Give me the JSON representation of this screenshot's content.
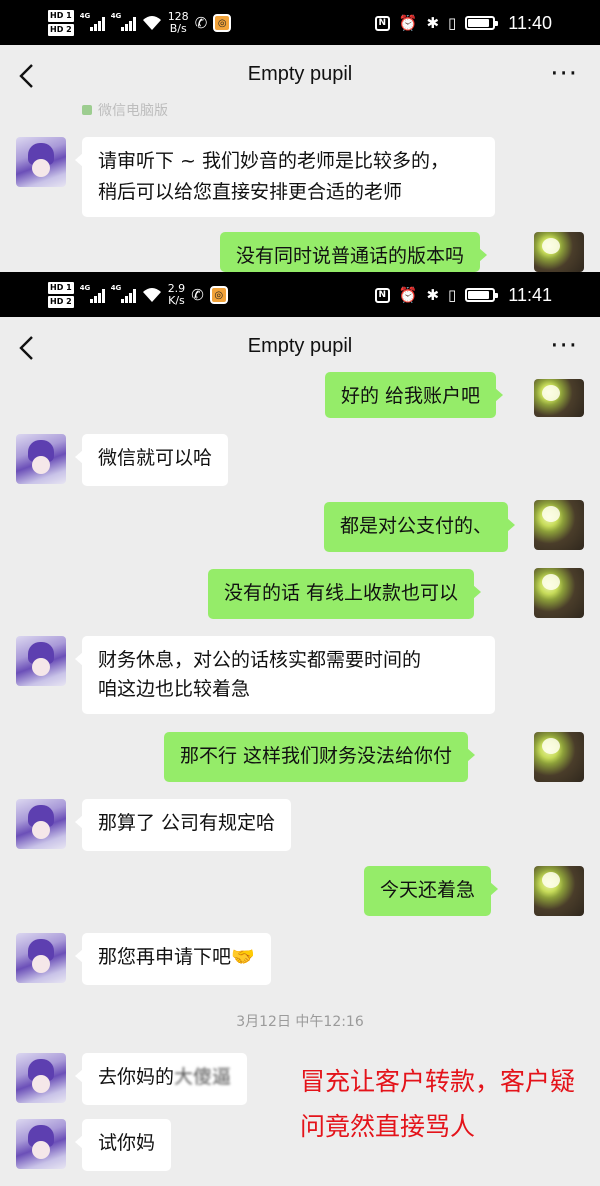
{
  "screen1": {
    "status": {
      "sim1": "HD 1",
      "sim2": "HD 2",
      "net": "4G",
      "speed_value": "128",
      "speed_unit": "B/s",
      "time": "11:40"
    },
    "header": {
      "title": "Empty pupil"
    },
    "cut_text": "微信电脑版",
    "messages": [
      {
        "side": "left",
        "lines": [
          "请审听下 ~ 我们妙音的老师是比较多的，",
          "稍后可以给您直接安排更合适的老师"
        ]
      },
      {
        "side": "right",
        "lines": [
          "没有同时说普通话的版本吗"
        ]
      }
    ]
  },
  "screen2": {
    "status": {
      "sim1": "HD 1",
      "sim2": "HD 2",
      "net": "4G",
      "speed_value": "2.9",
      "speed_unit": "K/s",
      "time": "11:41"
    },
    "header": {
      "title": "Empty pupil"
    },
    "messages": [
      {
        "side": "right",
        "text": "好的 给我账户吧"
      },
      {
        "side": "left",
        "text": "微信就可以哈"
      },
      {
        "side": "right",
        "text": "都是对公支付的、"
      },
      {
        "side": "right",
        "text": "没有的话  有线上收款也可以"
      },
      {
        "side": "left",
        "lines": [
          "财务休息，对公的话核实都需要时间的",
          "咱这边也比较着急"
        ]
      },
      {
        "side": "right",
        "text": "那不行  这样我们财务没法给你付"
      },
      {
        "side": "left",
        "text": "那算了 公司有规定哈"
      },
      {
        "side": "right",
        "text": "今天还着急"
      },
      {
        "side": "left",
        "text": "那您再申请下吧",
        "emoji": "🤝"
      }
    ],
    "timestamp": "3月12日 中午12:16",
    "messages_after": [
      {
        "side": "left",
        "text": "去你妈的",
        "blurred": "大傻逼"
      },
      {
        "side": "left",
        "text": "试你妈"
      }
    ],
    "annotation": {
      "line1": "冒充让客户转款，客户疑",
      "line2": "问竟然直接骂人",
      "color": "#e4131a"
    }
  },
  "colors": {
    "bubble_right": "#95ec69",
    "bubble_left": "#ffffff",
    "background": "#ededed",
    "statusbar": "#000000"
  },
  "icons": [
    "back-arrow-icon",
    "more-icon",
    "signal-icon",
    "wifi-icon",
    "missed-call-icon",
    "nfc-icon",
    "alarm-icon",
    "bluetooth-icon",
    "vibrate-icon",
    "battery-icon"
  ]
}
